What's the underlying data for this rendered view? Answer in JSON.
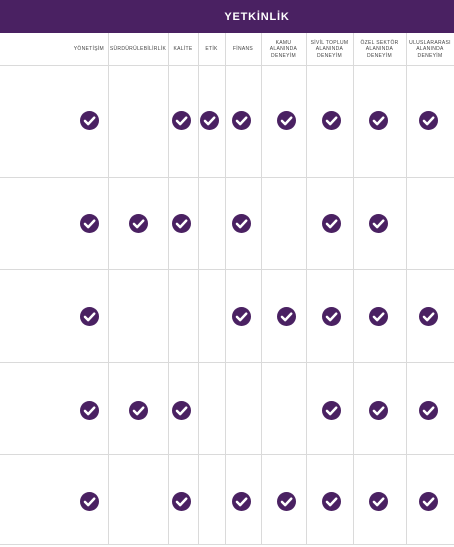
{
  "header": {
    "title": "YETKİNLİK"
  },
  "colors": {
    "accent": "#4a2162",
    "check_fill": "#4a2162",
    "grid": "#dadada"
  },
  "icon": "check-circle-icon",
  "columns": [
    "YÖNETİŞİM",
    "SÜRDÜRÜLEBİLİRLİK",
    "KALİTE",
    "ETİK",
    "FİNANS",
    "KAMU\nALANINDA\nDENEYİM",
    "SİVİL TOPLUM\nALANINDA\nDENEYİM",
    "ÖZEL SEKTÖR\nALANINDA\nDENEYİM",
    "ULUSLARARASI\nALANINDA\nDENEYİM"
  ],
  "rows": [
    [
      true,
      false,
      true,
      true,
      true,
      true,
      true,
      true,
      true
    ],
    [
      true,
      true,
      true,
      false,
      true,
      false,
      true,
      true,
      false
    ],
    [
      true,
      false,
      false,
      false,
      true,
      true,
      true,
      true,
      true
    ],
    [
      true,
      true,
      true,
      false,
      false,
      false,
      true,
      true,
      true
    ],
    [
      true,
      false,
      true,
      false,
      true,
      true,
      true,
      true,
      true
    ]
  ]
}
